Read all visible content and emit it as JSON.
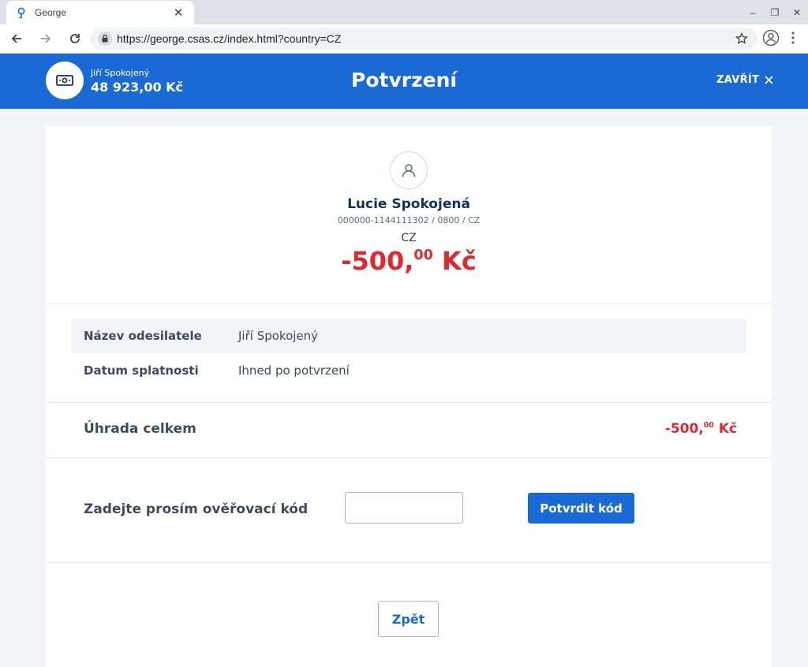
{
  "browser": {
    "tab_title": "George",
    "tab_close": "✕",
    "url": "https://george.csas.cz/index.html?country=CZ",
    "window_minimize": "–",
    "window_restore": "❐",
    "window_close": "✕"
  },
  "header": {
    "account_name": "Jiří Spokojený",
    "account_balance": "48 923,00 Kč",
    "title": "Potvrzení",
    "close_label": "ZAVŘÍT"
  },
  "recipient": {
    "name": "Lucie Spokojená",
    "account": "000000-1144111302 / 0800 / CZ",
    "country": "CZ",
    "amount_main": "-500,",
    "amount_decimals": "00",
    "currency": "Kč"
  },
  "details": [
    {
      "label": "Název odesilatele",
      "value": "Jiří Spokojený"
    },
    {
      "label": "Datum splatnosti",
      "value": "Ihned po potvrzení"
    }
  ],
  "total": {
    "label": "Úhrada celkem",
    "amount_main": "-500,",
    "amount_decimals": "00",
    "currency": "Kč"
  },
  "verification": {
    "label": "Zadejte prosím ověřovací kód",
    "input_value": "",
    "confirm_label": "Potvrdit kód"
  },
  "back_label": "Zpět",
  "colors": {
    "brand": "#1a6ad6",
    "negative_amount": "#e0282e",
    "background": "#f3f5f8"
  }
}
